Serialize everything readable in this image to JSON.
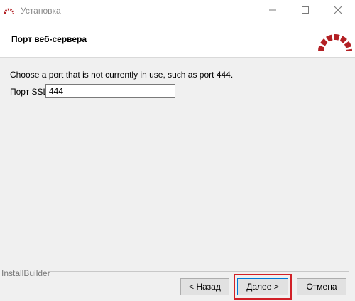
{
  "window": {
    "title": "Установка",
    "controls": [
      "minimize-icon",
      "maximize-icon",
      "close-icon"
    ]
  },
  "header": {
    "title": "Порт веб-сервера",
    "logo": "redmine-logo"
  },
  "content": {
    "description": "Choose a port that is not currently in use, such as port 444.",
    "port_label": "Порт SSL",
    "port_value": "444"
  },
  "footer": {
    "brand": "InstallBuilder",
    "back_label": "< Назад",
    "next_label": "Далее >",
    "cancel_label": "Отмена"
  },
  "colors": {
    "logo_red": "#b32024",
    "highlight": "#d12027",
    "background": "#f0f0f0"
  }
}
